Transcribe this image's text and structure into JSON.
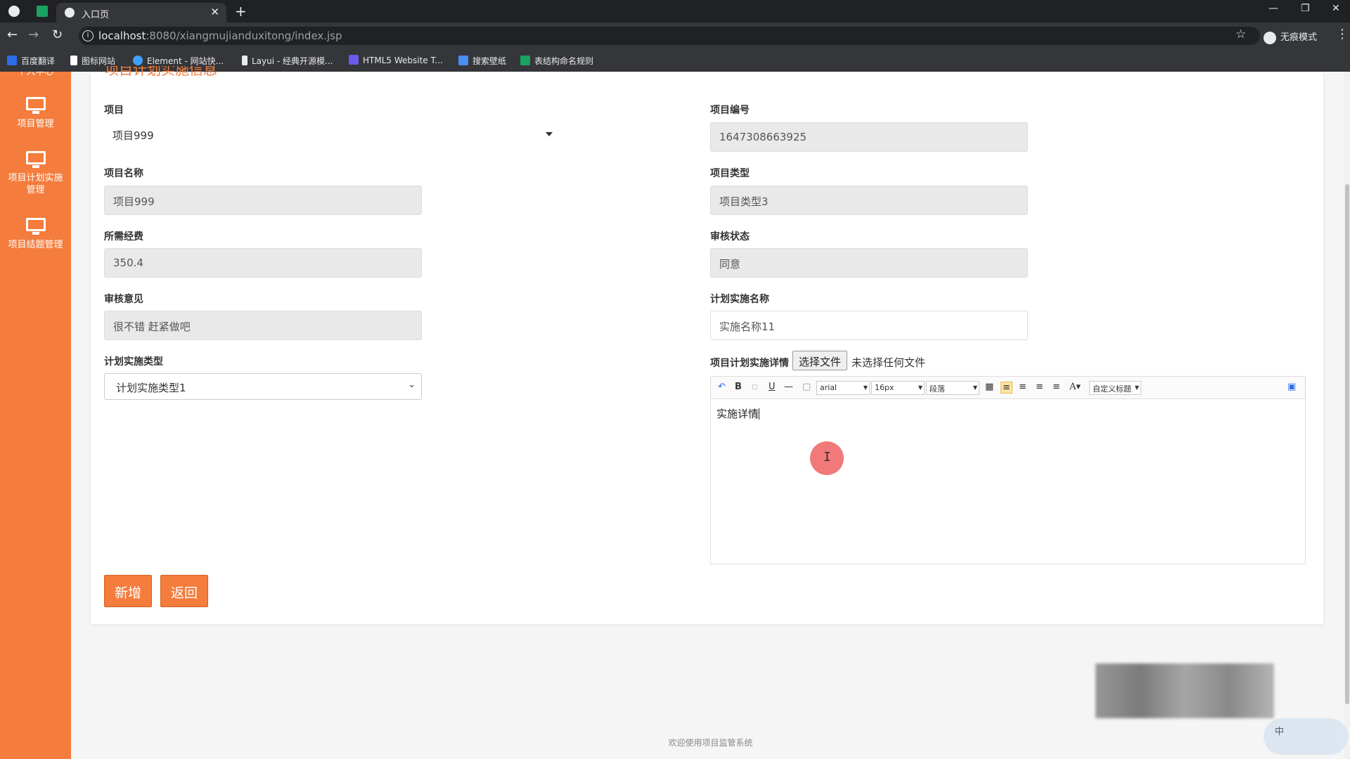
{
  "browser": {
    "tab_title": "入口页",
    "url_host": "localhost",
    "url_path": ":8080/xiangmujianduxitong/index.jsp",
    "incognito_label": "无痕模式",
    "bookmarks": [
      {
        "label": "百度翻译",
        "color": "#2b6de8"
      },
      {
        "label": "图标网站",
        "color": "#ffffff"
      },
      {
        "label": "Element - 网站快...",
        "color": "#409eff"
      },
      {
        "label": "Layui - 经典开源模...",
        "color": "#e8eaed"
      },
      {
        "label": "HTML5 Website T...",
        "color": "#6a5be8"
      },
      {
        "label": "搜索壁纸",
        "color": "#4a8ef0"
      },
      {
        "label": "表结构命名规则",
        "color": "#1aa260"
      }
    ]
  },
  "sidebar": {
    "clipped_item": "个人中心",
    "items": [
      {
        "label": "项目管理"
      },
      {
        "label": "项目计划实施管理"
      },
      {
        "label": "项目结题管理"
      }
    ]
  },
  "form": {
    "title": "项目计划实施信息",
    "project_label": "项目",
    "project_value": "项目999",
    "project_no_label": "项目编号",
    "project_no_value": "1647308663925",
    "project_name_label": "项目名称",
    "project_name_value": "项目999",
    "project_type_label": "项目类型",
    "project_type_value": "项目类型3",
    "cost_label": "所需经费",
    "cost_value": "350.4",
    "review_status_label": "审核状态",
    "review_status_value": "同意",
    "review_opinion_label": "审核意见",
    "review_opinion_value": "很不错 赶紧做吧",
    "plan_name_label": "计划实施名称",
    "plan_name_value": "实施名称11",
    "plan_type_label": "计划实施类型",
    "plan_type_value": "计划实施类型1",
    "detail_label": "项目计划实施详情",
    "file_button": "选择文件",
    "file_status": "未选择任何文件",
    "add_button": "新增",
    "back_button": "返回"
  },
  "editor": {
    "font_family": "arial",
    "font_size": "16px",
    "paragraph": "段落",
    "custom_heading": "自定义标题",
    "content": "实施详情"
  },
  "footer": {
    "text": "欢迎使用项目监管系统"
  },
  "ime": {
    "label": "中"
  },
  "colors": {
    "accent": "#f47c3c",
    "sidebar": "#f47c3c"
  }
}
